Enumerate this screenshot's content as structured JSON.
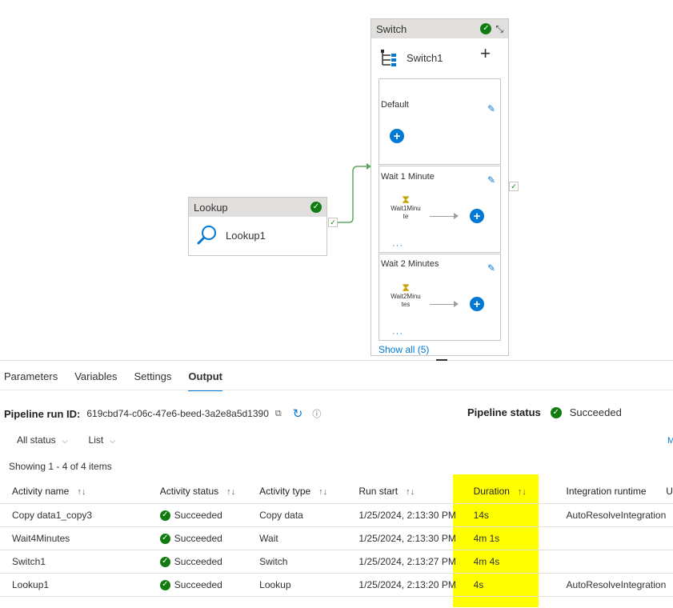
{
  "canvas": {
    "lookup": {
      "header": "Lookup",
      "name": "Lookup1"
    },
    "switch": {
      "header": "Switch",
      "name": "Switch1",
      "cases": [
        {
          "title": "Default"
        },
        {
          "title": "Wait 1 Minute",
          "activity_line1": "Wait1Minu",
          "activity_line2": "te"
        },
        {
          "title": "Wait 2 Minutes",
          "activity_line1": "Wait2Minu",
          "activity_line2": "tes"
        }
      ],
      "show_all": "Show all (5)"
    }
  },
  "panel": {
    "tabs": [
      "Parameters",
      "Variables",
      "Settings",
      "Output"
    ],
    "active_tab": "Output",
    "run_id_label": "Pipeline run ID:",
    "run_id": "619cbd74-c06c-47e6-beed-3a2e8a5d1390",
    "status_label": "Pipeline status",
    "status": "Succeeded",
    "filters": [
      "All status",
      "List"
    ],
    "cut_text": "M",
    "showing": "Showing 1 - 4 of 4 items",
    "columns": [
      "Activity name",
      "Activity status",
      "Activity type",
      "Run start",
      "Duration",
      "Integration runtime",
      "U"
    ],
    "rows": [
      {
        "name": "Copy data1_copy3",
        "status": "Succeeded",
        "type": "Copy data",
        "start": "1/25/2024, 2:13:30 PM",
        "duration": "14s",
        "runtime": "AutoResolveIntegration"
      },
      {
        "name": "Wait4Minutes",
        "status": "Succeeded",
        "type": "Wait",
        "start": "1/25/2024, 2:13:30 PM",
        "duration": "4m 1s",
        "runtime": ""
      },
      {
        "name": "Switch1",
        "status": "Succeeded",
        "type": "Switch",
        "start": "1/25/2024, 2:13:27 PM",
        "duration": "4m 4s",
        "runtime": ""
      },
      {
        "name": "Lookup1",
        "status": "Succeeded",
        "type": "Lookup",
        "start": "1/25/2024, 2:13:20 PM",
        "duration": "4s",
        "runtime": "AutoResolveIntegration"
      }
    ]
  },
  "colors": {
    "accent": "#0078d4",
    "success": "#107c10",
    "highlight": "#ffff00"
  }
}
